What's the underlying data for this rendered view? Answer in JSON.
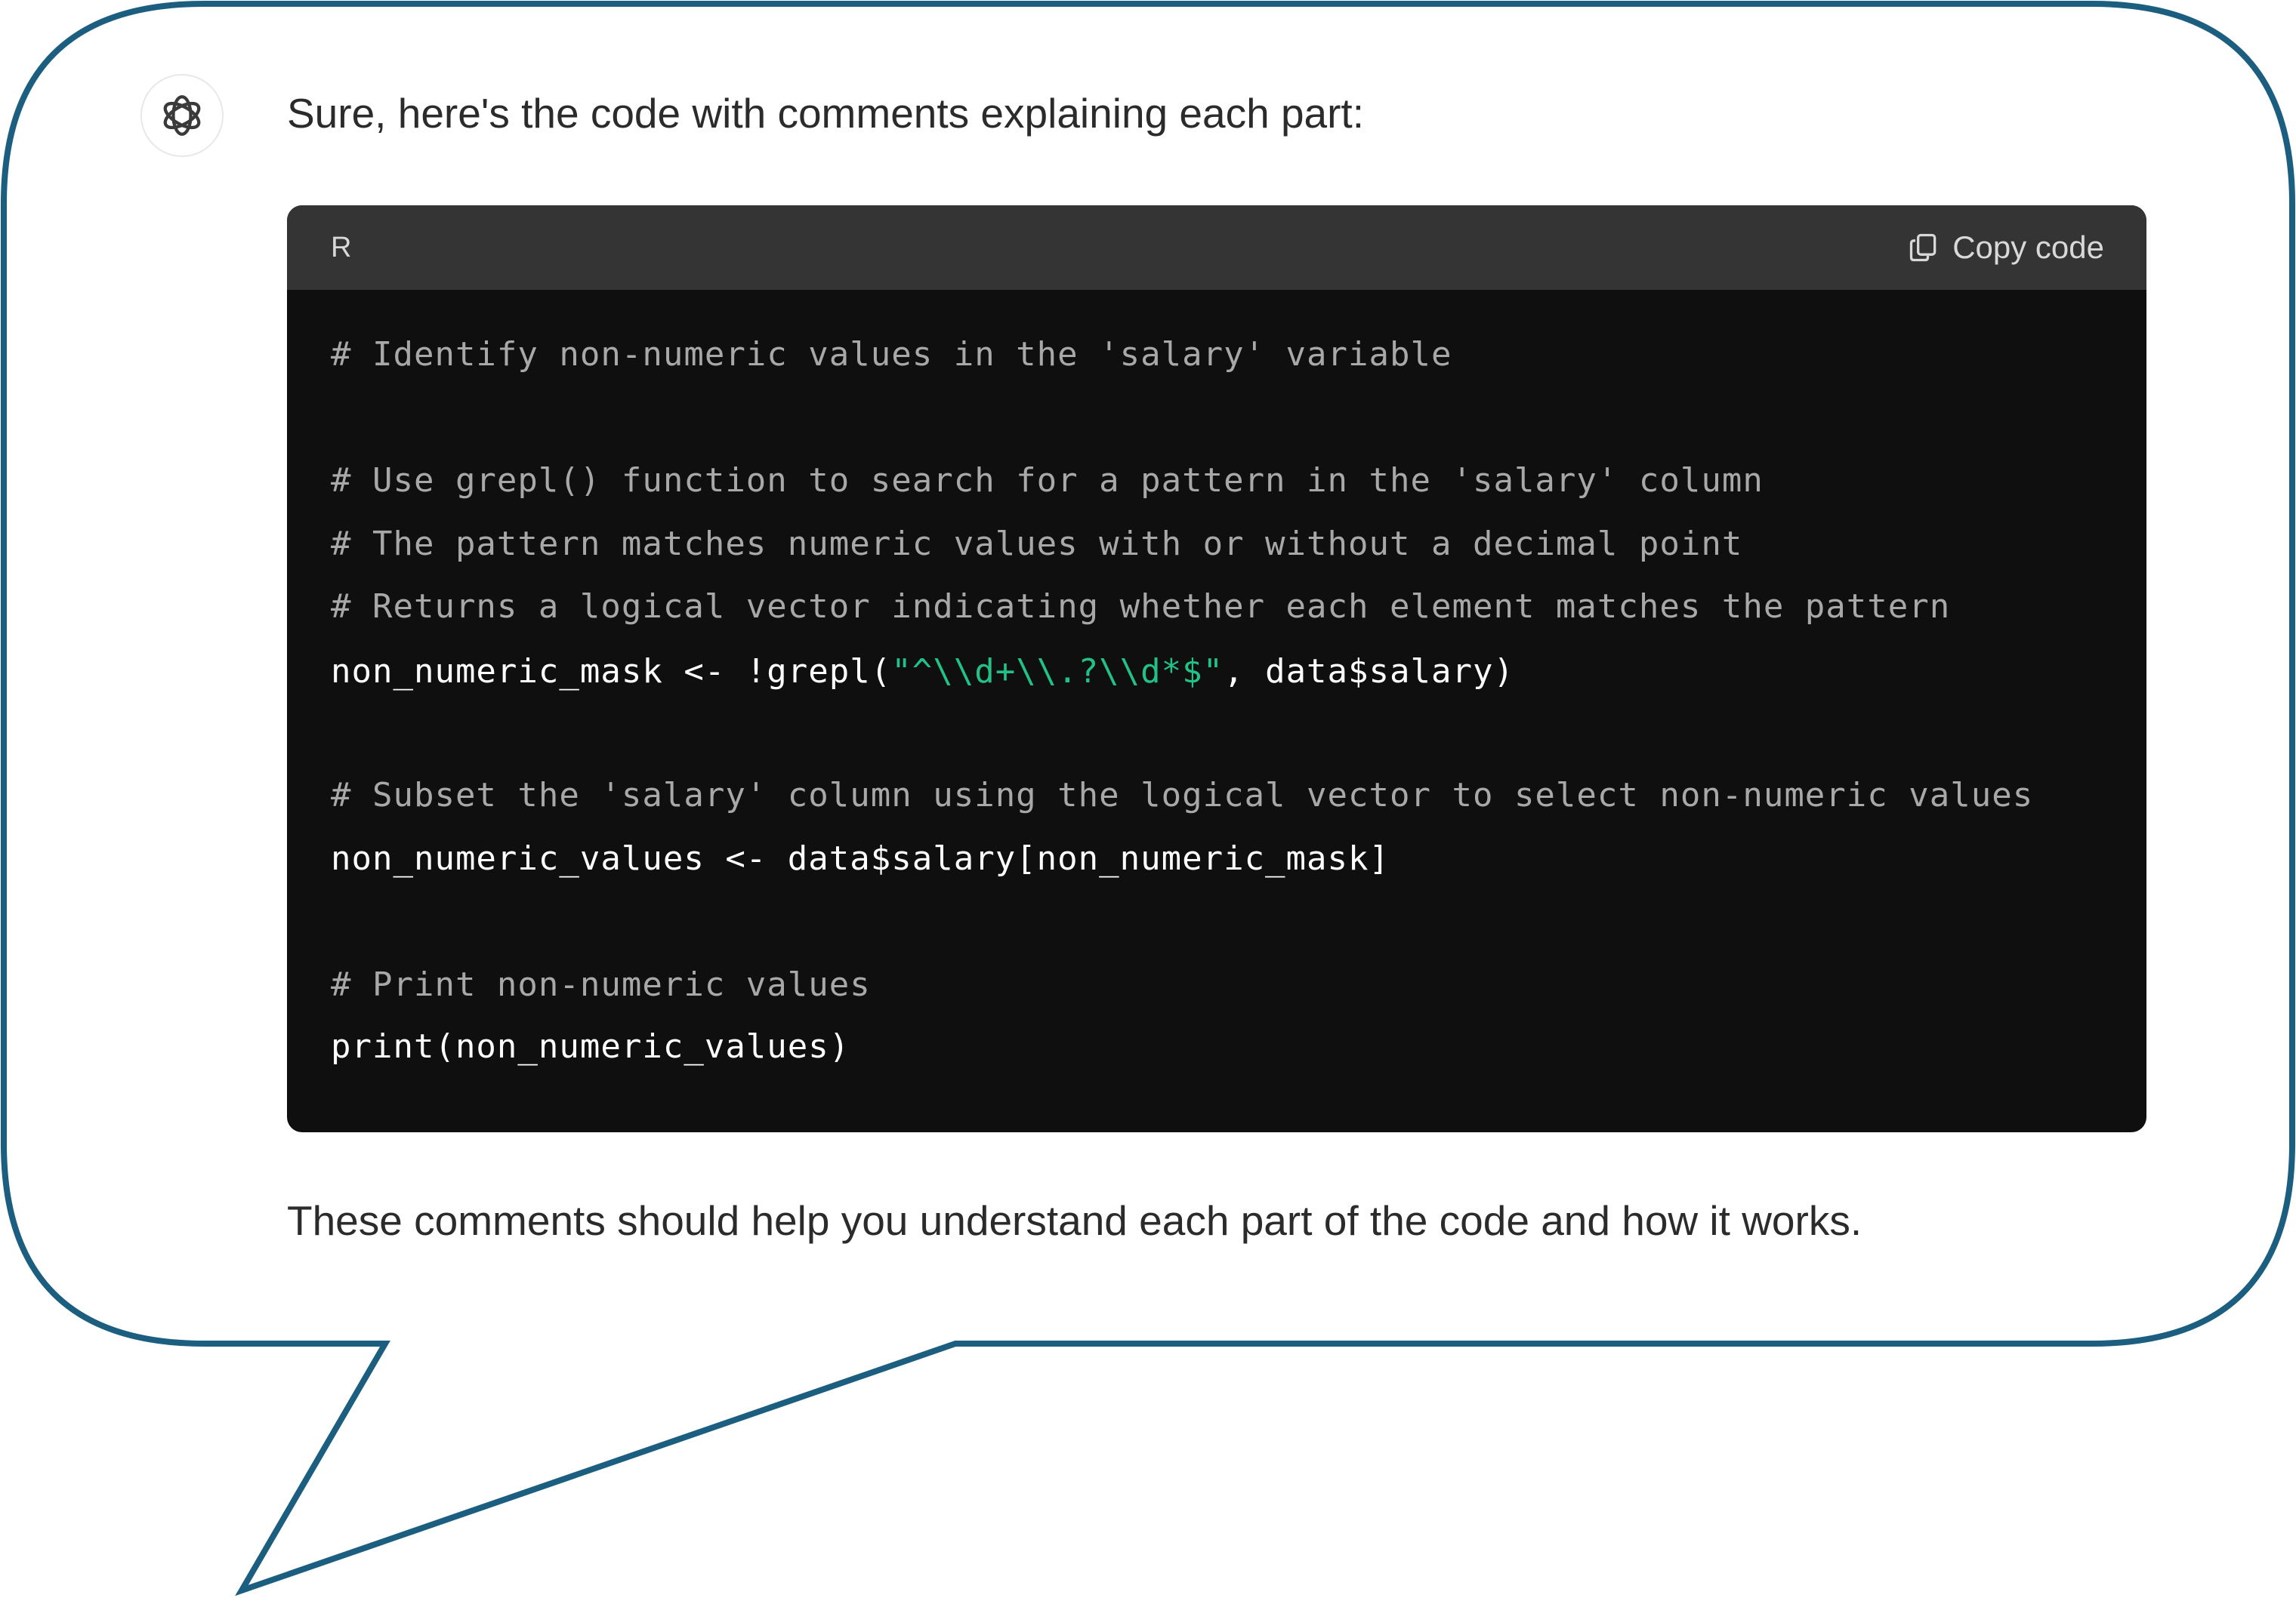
{
  "message": {
    "intro_text": "Sure, here's the code with comments explaining each part:",
    "outro_text": "These comments should help you understand each part of the code and how it works."
  },
  "avatar": {
    "icon": "openai-logo-icon"
  },
  "code_block": {
    "language": "R",
    "copy_label": "Copy code",
    "lines": {
      "l1": "# Identify non-numeric values in the 'salary' variable",
      "l2": "# Use grepl() function to search for a pattern in the 'salary' column",
      "l3": "# The pattern matches numeric values with or without a decimal point",
      "l4": "# Returns a logical vector indicating whether each element matches the pattern",
      "l5_pre": "non_numeric_mask <- !grepl(",
      "l5_str": "\"^\\\\d+\\\\.?\\\\d*$\"",
      "l5_post": ", data$salary)",
      "l6": "# Subset the 'salary' column using the logical vector to select non-numeric values",
      "l7": "non_numeric_values <- data$salary[non_numeric_mask]",
      "l8": "# Print non-numeric values",
      "l9": "print(non_numeric_values)"
    }
  },
  "colors": {
    "bubble_outline": "#1b5e80",
    "code_background": "#0f0f0f",
    "code_header": "#343434",
    "comment": "#a8a8a8",
    "string": "#22c187"
  }
}
